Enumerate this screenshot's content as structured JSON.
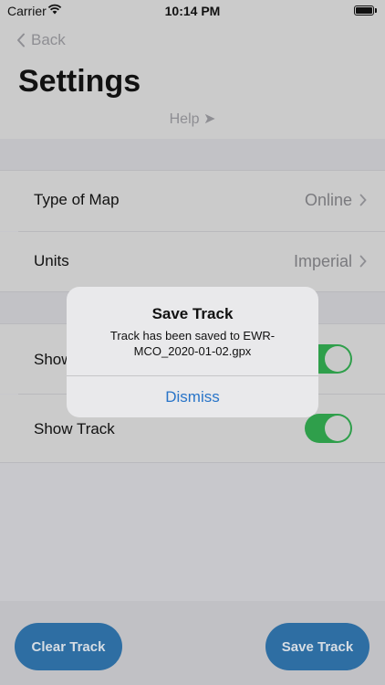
{
  "status_bar": {
    "carrier": "Carrier",
    "time": "10:14 PM"
  },
  "nav": {
    "back_label": "Back",
    "title": "Settings",
    "help_label": "Help ➤"
  },
  "settings": {
    "rows": [
      {
        "label": "Type of Map",
        "value": "Online"
      },
      {
        "label": "Units",
        "value": "Imperial"
      }
    ],
    "toggles": [
      {
        "label": "Show",
        "on": true
      },
      {
        "label": "Show Track",
        "on": true
      }
    ]
  },
  "buttons": {
    "clear_track": "Clear Track",
    "save_track": "Save Track"
  },
  "alert": {
    "title": "Save Track",
    "message": "Track has been saved to EWR-MCO_2020-01-02.gpx",
    "dismiss": "Dismiss"
  },
  "colors": {
    "accent": "#2e6ea3",
    "toggle_on": "#2f9f4b",
    "link": "#2874c8"
  },
  "icons": [
    "wifi-icon",
    "battery-icon",
    "back-chevron-icon",
    "disclosure-chevron-icon"
  ]
}
